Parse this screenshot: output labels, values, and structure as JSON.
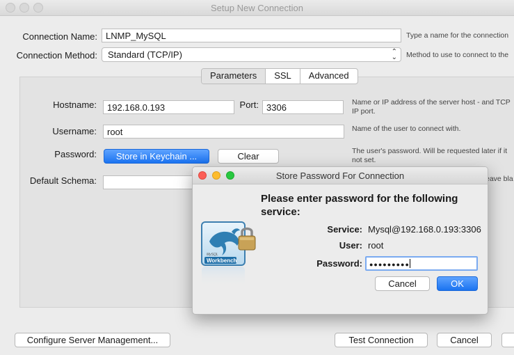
{
  "window": {
    "title": "Setup New Connection"
  },
  "form": {
    "connection_name_label": "Connection Name:",
    "connection_name_value": "LNMP_MySQL",
    "connection_name_hint": "Type a name for the connection",
    "connection_method_label": "Connection Method:",
    "connection_method_value": "Standard (TCP/IP)",
    "connection_method_hint": "Method to use to connect to the"
  },
  "tabs": [
    {
      "label": "Parameters",
      "active": true
    },
    {
      "label": "SSL",
      "active": false
    },
    {
      "label": "Advanced",
      "active": false
    }
  ],
  "parameters": {
    "hostname_label": "Hostname:",
    "hostname_value": "192.168.0.193",
    "port_label": "Port:",
    "port_value": "3306",
    "hostname_hint_1": "Name or IP address of the server host - and TCP",
    "hostname_hint_2": "IP port.",
    "username_label": "Username:",
    "username_value": "root",
    "username_hint": "Name of the user to connect with.",
    "password_label": "Password:",
    "store_keychain_label": "Store in Keychain ...",
    "clear_label": "Clear",
    "password_hint_1": "The user's password. Will be requested later if it",
    "password_hint_2": "not set.",
    "default_schema_label": "Default Schema:",
    "default_schema_value": "",
    "default_schema_hint": "eave bla"
  },
  "footer": {
    "configure_label": "Configure Server Management...",
    "test_label": "Test Connection",
    "cancel_label": "Cancel"
  },
  "dialog": {
    "title": "Store Password For Connection",
    "heading": "Please enter password for the following service:",
    "service_label": "Service:",
    "service_value": "Mysql@192.168.0.193:3306",
    "user_label": "User:",
    "user_value": "root",
    "password_label": "Password:",
    "password_masked": "●●●●●●●●●",
    "cancel_label": "Cancel",
    "ok_label": "OK",
    "logo_text_small": "MySQL",
    "logo_text": "Workbench"
  },
  "colors": {
    "accent": "#1b73f0",
    "close": "#fc5f57",
    "minimize": "#fdbc2e",
    "zoom": "#28c840"
  },
  "icons": [
    "window-close-icon",
    "window-minimize-icon",
    "window-zoom-icon",
    "chevron-updown-icon",
    "workbench-logo-icon",
    "padlock-icon"
  ]
}
